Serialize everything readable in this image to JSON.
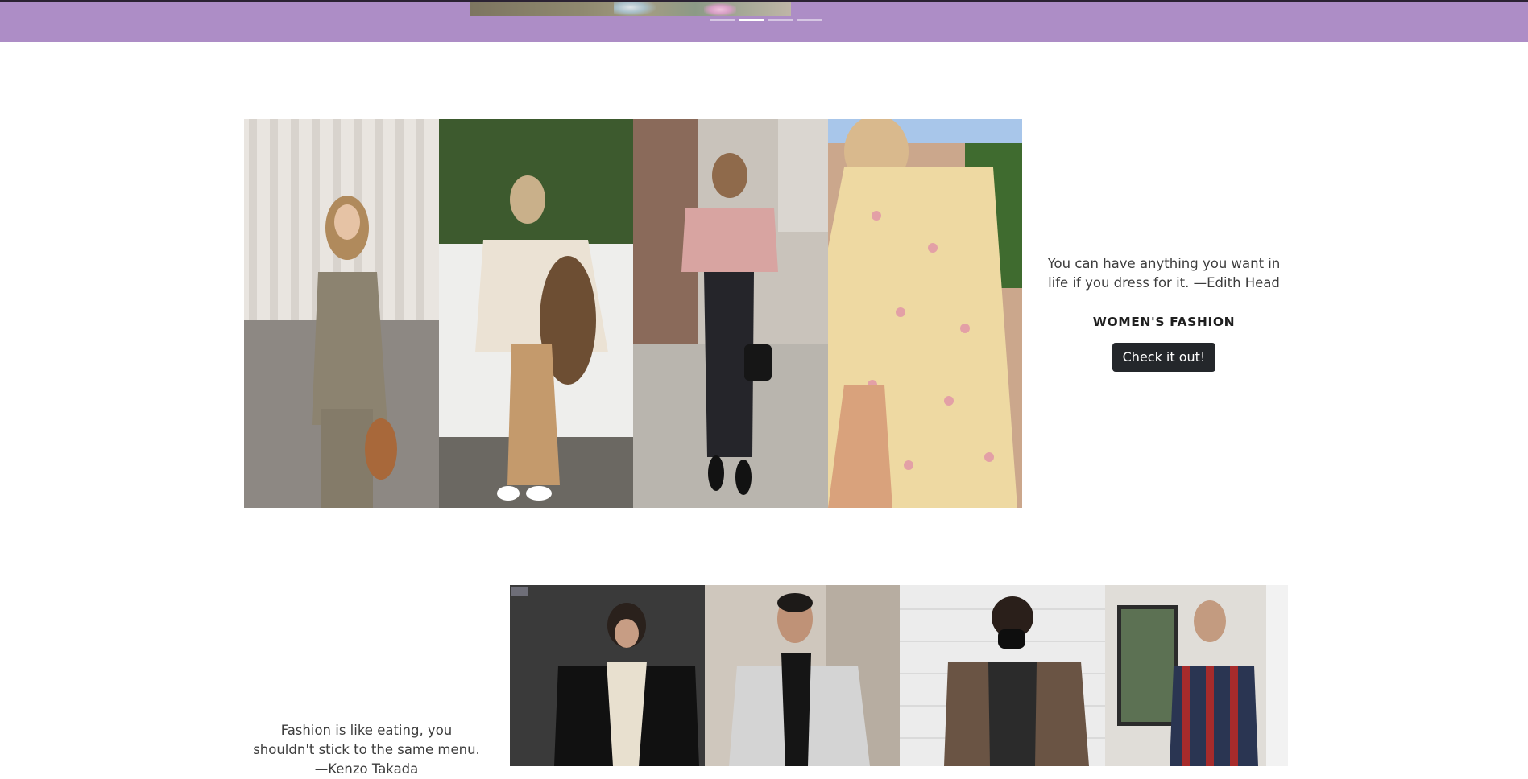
{
  "carousel": {
    "indicators": [
      {
        "label": "Slide 1",
        "active": false
      },
      {
        "label": "Slide 2",
        "active": true
      },
      {
        "label": "Slide 3",
        "active": false
      },
      {
        "label": "Slide 4",
        "active": false
      }
    ],
    "background": "#ad8dc6"
  },
  "women": {
    "quote": "You can have anything you want in life if you dress for it. —Edith Head",
    "label": "WOMEN'S FASHION",
    "button": "Check it out!",
    "photos": [
      "plaid-suit-photo",
      "teddy-sweater-photo",
      "pink-sweater-photo",
      "floral-dress-photo"
    ]
  },
  "men": {
    "quote": "Fashion is like eating, you shouldn't stick to the same menu. —Kenzo Takada",
    "photos": [
      "puffer-jacket-photo",
      "grey-coat-photo",
      "flannel-shirt-photo",
      "striped-shirt-photo"
    ]
  },
  "colors": {
    "button_bg": "#24272b",
    "text": "#3d3d3d"
  }
}
